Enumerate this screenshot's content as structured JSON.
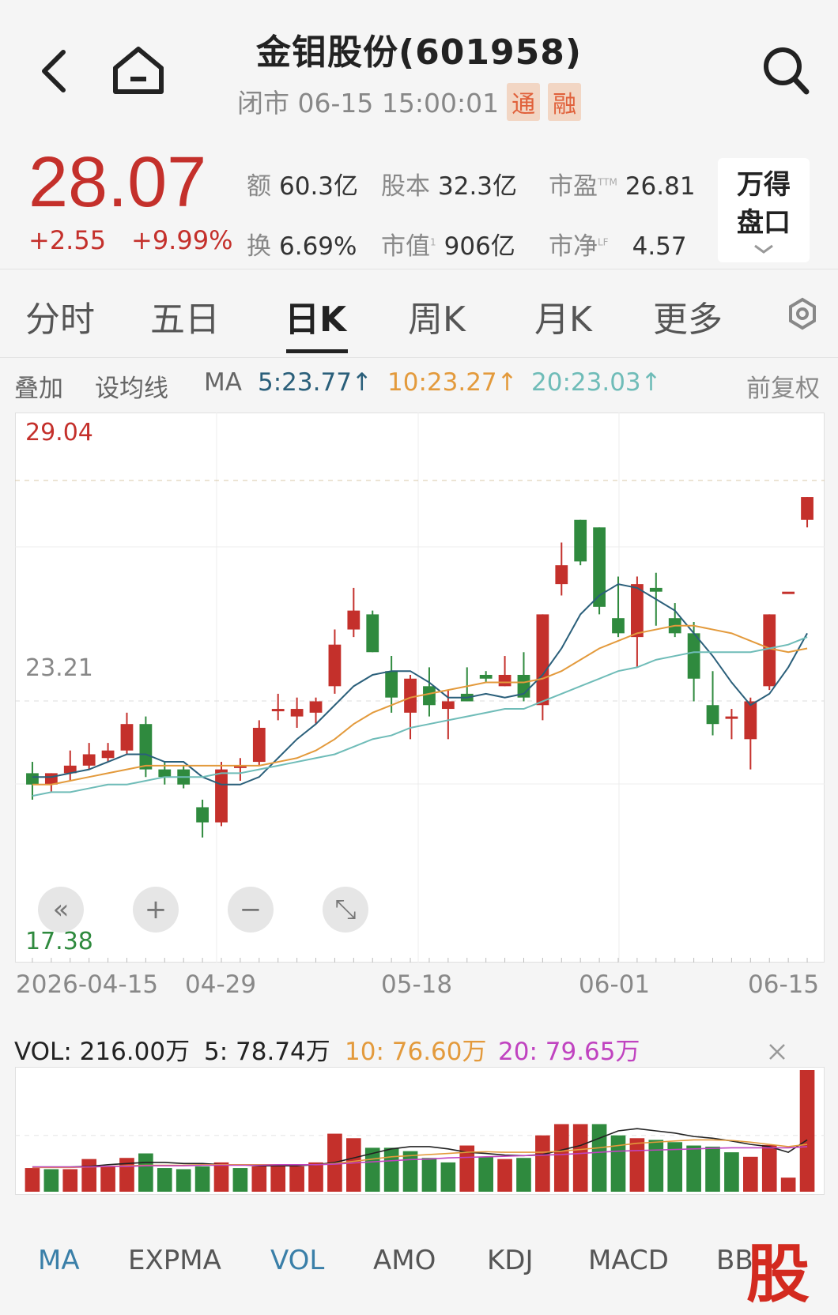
{
  "header": {
    "title": "金钼股份(601958)",
    "status": "闭市 06-15 15:00:01",
    "badges": [
      "通",
      "融"
    ]
  },
  "quote": {
    "price": "28.07",
    "change": "+2.55",
    "change_pct": "+9.99%",
    "stats": [
      {
        "label": "额",
        "value": "60.3亿"
      },
      {
        "label": "股本",
        "value": "32.3亿"
      },
      {
        "label": "市盈",
        "sup": "TTM",
        "value": "26.81"
      },
      {
        "label": "换",
        "value": "6.69%"
      },
      {
        "label": "市值",
        "sup": "1",
        "value": "906亿"
      },
      {
        "label": "市净",
        "sup": "LF",
        "value": "4.57"
      }
    ],
    "wande_button": [
      "万得",
      "盘口"
    ]
  },
  "tabs": [
    "分时",
    "五日",
    "日K",
    "周K",
    "月K",
    "更多"
  ],
  "active_tab": "日K",
  "ma_bar": {
    "overlay": "叠加",
    "set_ma": "设均线",
    "ma_label": "MA",
    "ma5": "5:23.77↑",
    "ma10": "10:23.27↑",
    "ma20": "20:23.03↑",
    "adjust": "前复权"
  },
  "colors": {
    "up": "#c4302b",
    "down": "#2f8a3e",
    "ma5": "#2a5f7a",
    "ma10": "#e39a3c",
    "ma20": "#6fbcb8",
    "vol_ma20": "#c043c0"
  },
  "chart_data": {
    "type": "candlestick",
    "y_labels": {
      "high": "29.04",
      "mid": "23.21",
      "low": "17.38"
    },
    "ylim": [
      17.38,
      29.04
    ],
    "x_labels": [
      "2026-04-15",
      "04-29",
      "05-18",
      "06-01",
      "06-15"
    ],
    "candles": [
      [
        21.3,
        21.0,
        21.6,
        20.6
      ],
      [
        21.0,
        21.3,
        21.3,
        20.8
      ],
      [
        21.3,
        21.5,
        21.9,
        21.1
      ],
      [
        21.5,
        21.8,
        22.1,
        21.4
      ],
      [
        21.7,
        21.9,
        22.1,
        21.6
      ],
      [
        21.9,
        22.6,
        22.9,
        21.8
      ],
      [
        22.6,
        21.4,
        22.8,
        21.2
      ],
      [
        21.4,
        21.2,
        21.6,
        21.0
      ],
      [
        21.4,
        21.0,
        21.5,
        20.9
      ],
      [
        20.4,
        20.0,
        20.6,
        19.6
      ],
      [
        20.0,
        21.4,
        21.6,
        19.9
      ],
      [
        21.5,
        21.5,
        21.7,
        21.1
      ],
      [
        21.6,
        22.5,
        22.7,
        21.5
      ],
      [
        23.0,
        23.0,
        23.4,
        22.7
      ],
      [
        22.8,
        23.0,
        23.3,
        22.5
      ],
      [
        22.9,
        23.2,
        23.3,
        22.6
      ],
      [
        23.6,
        24.7,
        25.1,
        23.4
      ],
      [
        25.1,
        25.6,
        26.2,
        24.9
      ],
      [
        25.5,
        24.5,
        25.6,
        24.5
      ],
      [
        24.0,
        23.3,
        24.4,
        22.9
      ],
      [
        22.9,
        23.8,
        23.9,
        22.2
      ],
      [
        23.6,
        23.1,
        24.1,
        22.8
      ],
      [
        23.0,
        23.2,
        23.5,
        22.2
      ],
      [
        23.4,
        23.2,
        24.1,
        23.2
      ],
      [
        23.9,
        23.8,
        24.0,
        23.7
      ],
      [
        23.6,
        23.9,
        24.4,
        23.6
      ],
      [
        23.9,
        23.3,
        24.5,
        23.2
      ],
      [
        23.1,
        25.5,
        25.5,
        22.7
      ],
      [
        26.3,
        26.8,
        27.4,
        26.0
      ],
      [
        28.0,
        26.9,
        28.0,
        26.8
      ],
      [
        27.8,
        25.7,
        27.8,
        25.5
      ],
      [
        25.4,
        25.0,
        26.5,
        24.9
      ],
      [
        24.9,
        26.3,
        26.5,
        24.1
      ],
      [
        26.2,
        26.1,
        26.6,
        25.2
      ],
      [
        25.4,
        25.0,
        25.8,
        24.9
      ],
      [
        25.0,
        23.8,
        25.3,
        23.2
      ],
      [
        23.1,
        22.6,
        24.0,
        22.3
      ],
      [
        22.8,
        22.8,
        23.0,
        22.2
      ],
      [
        22.2,
        23.2,
        23.3,
        21.4
      ],
      [
        23.6,
        25.5,
        25.5,
        23.5
      ],
      [
        26.1,
        26.1,
        26.1,
        26.1
      ],
      [
        28.0,
        28.6,
        28.6,
        27.8
      ]
    ],
    "ma5": [
      21.2,
      21.2,
      21.3,
      21.4,
      21.6,
      21.8,
      21.8,
      21.6,
      21.6,
      21.2,
      21.0,
      21.0,
      21.2,
      21.7,
      22.2,
      22.6,
      23.1,
      23.6,
      23.9,
      24.0,
      24.0,
      23.7,
      23.3,
      23.3,
      23.4,
      23.3,
      23.4,
      23.9,
      24.6,
      25.5,
      26.0,
      26.3,
      26.2,
      25.9,
      25.6,
      25.0,
      24.4,
      23.7,
      23.1,
      23.4,
      24.1,
      25.0
    ],
    "ma10": [
      21.0,
      21.0,
      21.1,
      21.2,
      21.3,
      21.4,
      21.5,
      21.5,
      21.5,
      21.5,
      21.5,
      21.5,
      21.5,
      21.6,
      21.7,
      21.9,
      22.2,
      22.6,
      22.9,
      23.1,
      23.3,
      23.4,
      23.5,
      23.6,
      23.7,
      23.7,
      23.7,
      23.8,
      24.0,
      24.3,
      24.6,
      24.8,
      25.0,
      25.1,
      25.2,
      25.2,
      25.1,
      25.0,
      24.8,
      24.6,
      24.5,
      24.6
    ],
    "ma20": [
      20.7,
      20.8,
      20.8,
      20.9,
      21.0,
      21.0,
      21.1,
      21.2,
      21.2,
      21.2,
      21.3,
      21.3,
      21.4,
      21.5,
      21.6,
      21.7,
      21.8,
      22.0,
      22.2,
      22.3,
      22.5,
      22.6,
      22.7,
      22.8,
      22.9,
      23.0,
      23.0,
      23.2,
      23.4,
      23.6,
      23.8,
      24.0,
      24.1,
      24.3,
      24.4,
      24.5,
      24.5,
      24.5,
      24.5,
      24.6,
      24.7,
      24.9
    ]
  },
  "vol_bar": {
    "vol": "VOL: 216.00万",
    "ma5": "5: 78.74万",
    "ma10": "10: 76.60万",
    "ma20": "20: 79.65万"
  },
  "vol_data": {
    "max": 216,
    "values": [
      42,
      40,
      40,
      58,
      45,
      60,
      68,
      42,
      40,
      45,
      52,
      42,
      45,
      48,
      45,
      52,
      103,
      95,
      78,
      78,
      72,
      60,
      52,
      82,
      62,
      58,
      60,
      100,
      120,
      120,
      120,
      100,
      95,
      92,
      88,
      82,
      80,
      70,
      62,
      83,
      25,
      216
    ],
    "up": [
      true,
      false,
      true,
      true,
      true,
      true,
      false,
      false,
      false,
      false,
      true,
      false,
      true,
      true,
      true,
      true,
      true,
      true,
      false,
      false,
      false,
      false,
      false,
      true,
      false,
      true,
      false,
      true,
      true,
      true,
      false,
      false,
      true,
      false,
      false,
      false,
      false,
      false,
      true,
      true,
      true,
      true
    ],
    "ma5": [
      44,
      44,
      44,
      45,
      48,
      50,
      52,
      52,
      50,
      50,
      48,
      48,
      46,
      46,
      46,
      48,
      52,
      60,
      68,
      76,
      80,
      80,
      76,
      70,
      68,
      65,
      64,
      66,
      74,
      82,
      95,
      108,
      112,
      108,
      104,
      98,
      95,
      90,
      84,
      80,
      70,
      92
    ],
    "ma10": [
      43,
      43,
      43,
      44,
      45,
      46,
      47,
      47,
      47,
      48,
      48,
      48,
      48,
      48,
      48,
      48,
      50,
      54,
      58,
      62,
      64,
      66,
      68,
      70,
      71,
      70,
      70,
      70,
      72,
      75,
      78,
      82,
      86,
      88,
      90,
      92,
      92,
      91,
      88,
      84,
      80,
      84
    ],
    "ma20": [
      44,
      44,
      44,
      44,
      45,
      45,
      46,
      46,
      46,
      47,
      47,
      47,
      47,
      48,
      48,
      48,
      49,
      51,
      53,
      55,
      57,
      58,
      60,
      61,
      62,
      63,
      64,
      65,
      66,
      68,
      70,
      72,
      73,
      74,
      75,
      76,
      77,
      78,
      78,
      78,
      78,
      80
    ]
  },
  "indicators": [
    "MA",
    "EXPMA",
    "VOL",
    "AMO",
    "KDJ",
    "MACD",
    "BB"
  ]
}
